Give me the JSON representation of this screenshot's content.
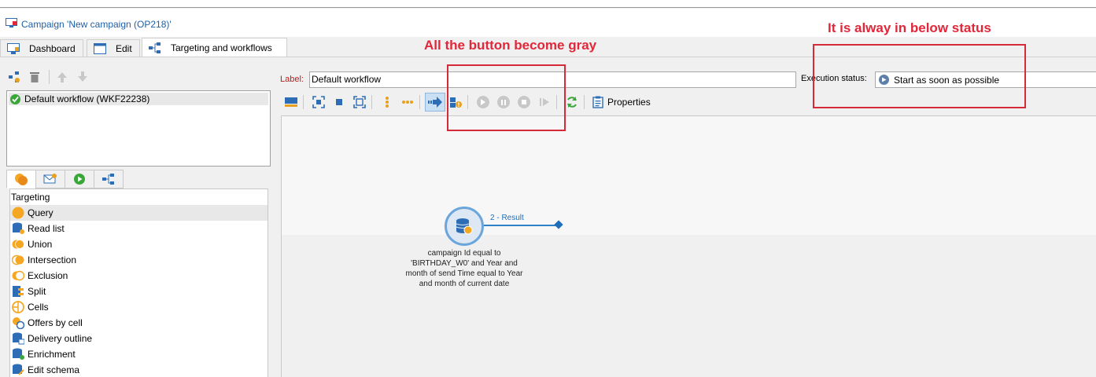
{
  "window": {
    "title": "Campaign 'New campaign (OP218)'"
  },
  "tabs": [
    {
      "label": "Dashboard",
      "icon": "dashboard-icon"
    },
    {
      "label": "Edit",
      "icon": "edit-form-icon"
    },
    {
      "label": "Targeting and workflows",
      "icon": "workflow-icon",
      "active": true
    }
  ],
  "annotations": {
    "gray_buttons": "All the button become gray",
    "status_note": "It is alway in below status",
    "color": "#e0283a"
  },
  "workflows": {
    "items": [
      {
        "label": "Default workflow (WKF22238)",
        "status": "ok"
      }
    ]
  },
  "form": {
    "label_caption": "Label:",
    "label_value": "Default workflow",
    "exec_caption": "Execution status:",
    "exec_value": "Start as soon as possible"
  },
  "toolbar": {
    "properties_label": "Properties"
  },
  "palette": {
    "heading": "Targeting",
    "items": [
      {
        "label": "Query",
        "icon": "query-icon",
        "selected": true
      },
      {
        "label": "Read list",
        "icon": "read-list-icon"
      },
      {
        "label": "Union",
        "icon": "union-icon"
      },
      {
        "label": "Intersection",
        "icon": "intersection-icon"
      },
      {
        "label": "Exclusion",
        "icon": "exclusion-icon"
      },
      {
        "label": "Split",
        "icon": "split-icon"
      },
      {
        "label": "Cells",
        "icon": "cells-icon"
      },
      {
        "label": "Offers by cell",
        "icon": "offers-by-cell-icon"
      },
      {
        "label": "Delivery outline",
        "icon": "delivery-outline-icon"
      },
      {
        "label": "Enrichment",
        "icon": "enrichment-icon"
      },
      {
        "label": "Edit schema",
        "icon": "edit-schema-icon"
      }
    ]
  },
  "canvas": {
    "node": {
      "transition": "2 - Result",
      "description": "campaign Id equal to 'BIRTHDAY_W0' and Year and month of send Time equal to Year and month of current date"
    }
  },
  "colors": {
    "accent": "#1f6fb8",
    "title_text": "#1f5fa8",
    "disabled": "#c8c8c8",
    "ok": "#3aa63a"
  }
}
